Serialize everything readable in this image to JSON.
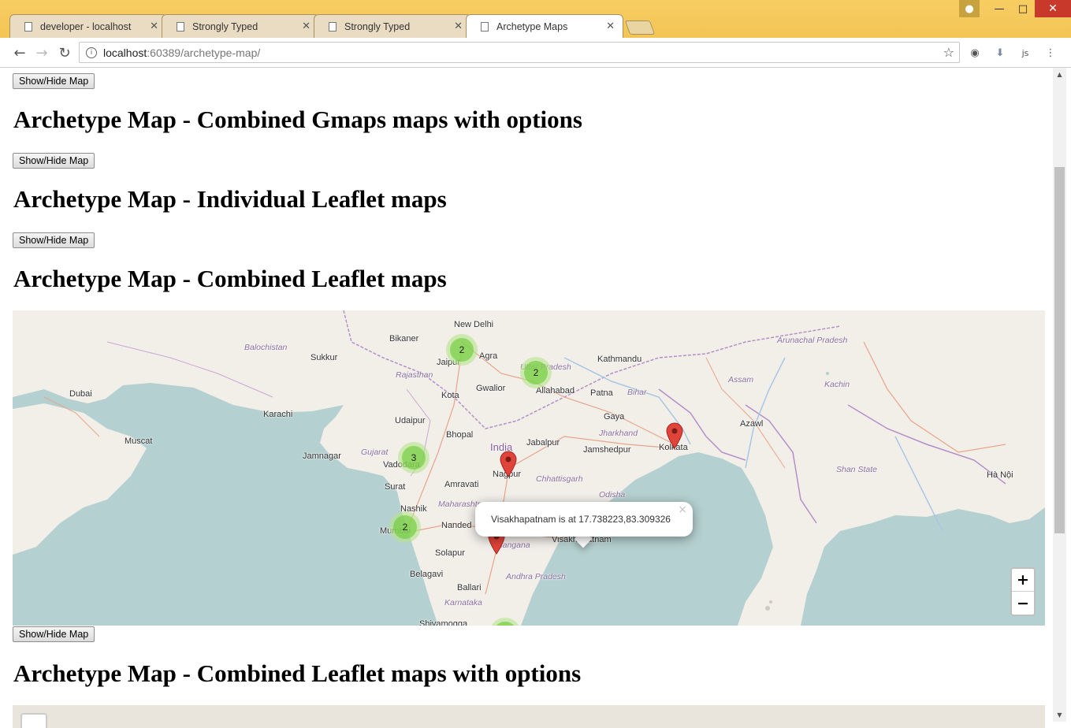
{
  "browser": {
    "tabs": [
      {
        "title": "developer - localhost",
        "active": false
      },
      {
        "title": "Strongly Typed",
        "active": false
      },
      {
        "title": "Strongly Typed",
        "active": false
      },
      {
        "title": "Archetype Maps",
        "active": true
      }
    ],
    "url_host": "localhost",
    "url_rest": ":60389/archetype-map/",
    "window_controls": {
      "minimize": "—",
      "maximize": "□",
      "close": "✕"
    }
  },
  "page": {
    "toggle_label": "Show/Hide Map",
    "headings": [
      "Archetype Map - Combined Gmaps maps with options",
      "Archetype Map - Individual Leaflet maps",
      "Archetype Map - Combined Leaflet maps",
      "Archetype Map - Combined Leaflet maps with options"
    ]
  },
  "map": {
    "popup_text": "Visakhapatnam is at 17.738223,83.309326",
    "zoom_in": "+",
    "zoom_out": "−",
    "clusters": [
      {
        "count": "2"
      },
      {
        "count": "2"
      },
      {
        "count": "3"
      },
      {
        "count": "2"
      }
    ],
    "places": [
      "New Delhi",
      "Bikaner",
      "Jaipur",
      "Agra",
      "Sukkur",
      "Karachi",
      "Gwalior",
      "Allahabad",
      "Patna",
      "Kathmandu",
      "Kota",
      "Udaipur",
      "Bhopal",
      "Jabalpur",
      "Gaya",
      "Jamnagar",
      "Vadodara",
      "Nagpur",
      "Jamshedpur",
      "Kolkata",
      "Amravati",
      "Surat",
      "Nashik",
      "Nanded",
      "Mumbai",
      "Solapur",
      "Visakhapatnam",
      "Belagavi",
      "Ballari",
      "Shivamogga",
      "Dubai",
      "Muscat",
      "India",
      "Rajasthan",
      "Gujarat",
      "Maharashtra",
      "Chhattisgarh",
      "Odisha",
      "Jharkhand",
      "Bihar",
      "Telangana",
      "Andhra Pradesh",
      "Karnataka",
      "Assam",
      "Azawl",
      "Kachin",
      "Shan State",
      "Arunachal Pradesh",
      "Hà Nội",
      "Balochistan",
      "Uttar Pradesh"
    ],
    "colors": {
      "water": "#b5d0d0",
      "land": "#f2efe9",
      "marker": "#e0433a",
      "cluster": "#6ecc39"
    }
  }
}
